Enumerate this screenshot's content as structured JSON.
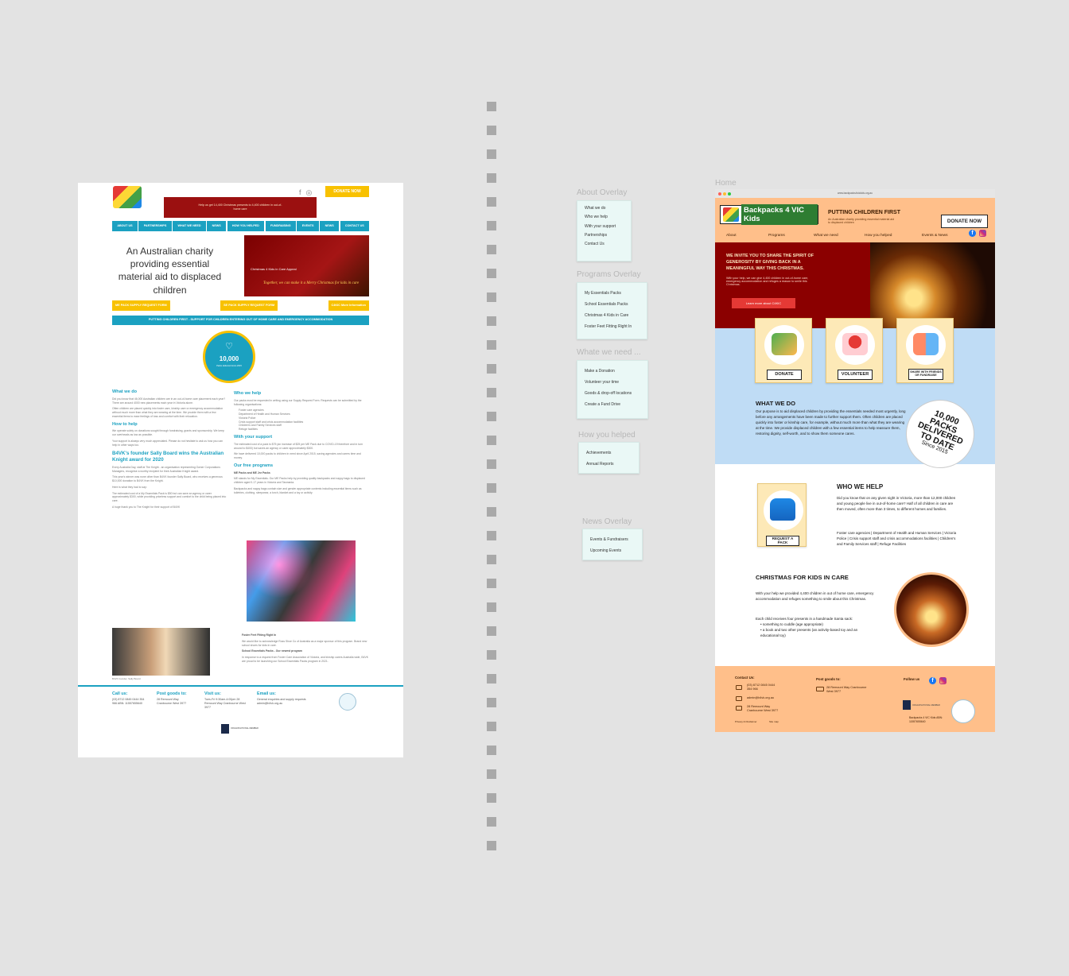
{
  "old_site": {
    "donate": "DONATE NOW",
    "banner": "Help us get 14,400 Christmas presents to 4,400 children in out-of-home care",
    "nav": [
      "ABOUT US",
      "PARTNERSHIPS",
      "WHAT WE NEED",
      "NEWS",
      "HOW YOU HELPED",
      "FUNDRAISING",
      "EVENTS",
      "NEWS",
      "CONTACT US"
    ],
    "hero_title": "An Australian charity providing essential material aid to displaced children",
    "hero_caption": "Christmas 4 Kids in Care Appeal",
    "hero_script": "Together, we can make it a Merry Christmas for kids in care",
    "buttons": [
      "ME PACK SUPPLY REQUEST FORM",
      "SE PACK SUPPLY REQUEST FORM",
      "C4KIC More Information"
    ],
    "strip": "PUTTING CHILDREN FIRST - SUPPORT FOR CHILDREN ENTERING OUT OF HOME CARE AND EMERGENCY ACCOMMODATION",
    "counter_num": "10,000",
    "counter_label": "Packs delivered since 2015",
    "what_we_do_h": "What we do",
    "what_we_do_p": "Did you know that 46,000 Australian children are in an out-of-home care placement each year? There are around 4000 new placements each year in Victoria alone.",
    "what_we_do_p2": "Often children are placed quickly into foster care, kinship care or emergency accommodation without much more than what they are wearing at the time. We provide them with a few essential items to ease feelings of loss and comfort with their relocation.",
    "how_to_help_h": "How to help",
    "how_to_help_p": "We operate solely on donations sought through fundraising, grants and sponsorship. We keep our overheads as low as possible.",
    "how_to_help_p2": "Your support is always very much appreciated. Please do not hesitate to ask us how you can help in other ways too.",
    "award_h": "B4VK's founder Sally Board wins the Australian Knight award for 2020",
    "award_p": "Every Australia Day, staff at The Knight - an organisation representing Owner Corporations Managers, recognise a worthy recipient for their Australian Knight award.",
    "award_p2": "This year's winner was none other than B4VK founder Sally Board, who receives a generous $10,000 donation to B4VK from the Knight.",
    "award_p3": "Here is what they had to say:",
    "award_p4": "The estimated cost of a My Essentials Pack is $50 but can save an agency or carer approximately $300, while providing priceless support and comfort to the child being placed into care.",
    "award_p5": "A huge thank you to The Knight for their support of B4VK",
    "sally_caption": "B4VK founder, Sally Board",
    "who_we_help_h": "Who we help",
    "who_we_help_p": "Our packs must be requested in writing using our Supply Request Form. Requests can be submitted by the following organisations:",
    "who_we_help_list": [
      "Foster care agencies",
      "Department of Health and Human Services",
      "Victoria Police",
      "Crisis support staff and crisis accommodation facilities",
      "Children's and Family Services staff",
      "Refuge facilities"
    ],
    "support_h": "With your support",
    "support_p": "The estimated cost of a pack is $75 (an increase of $25 per ME Pack due to COVID-19 therefore and in turn around to $400) but saves an agency or carer approximately $300.",
    "support_p2": "We have delivered 10,000 packs to children in need since April 2015, saving agencies and carers time and money.",
    "programs_h": "Our free programs",
    "programs_sub": "ME Packs and ME Jnr Packs",
    "programs_p": "ME stands for My Essentials. Our ME Packs help by providing quality backpacks and nappy bags to displaced children aged 0-17 years in Victoria and Tasmania.",
    "programs_p2": "Backpacks and nappy bags contain size and gender appropriate contents including essential items such as toiletries, clothing, sleepwear, a torch, blanket and a toy or activity.",
    "foster_h": "Foster Feet Fitting Right In",
    "foster_p": "We would like to acknowledge Ross Shoe Co of Australia as a major sponsor of this program. Brand new school shoes for kids in care.",
    "school_h": "School Essentials Packs - Our newest program",
    "school_p": "In response to a request from Foster Care Association of Victoria, and kinship carers Australia wide, B4VK are proud to be launching our School Essentials Packs program in 2021.",
    "footer": [
      {
        "h": "Call us:",
        "t": "(03) 8712 0845 0444 354 966 ABN: 11557655640"
      },
      {
        "h": "Post goods to:",
        "t": "28 Remount Way Cranbourne West 3977"
      },
      {
        "h": "Visit us:",
        "t": "Tues-Fri 9:30am-4:00pm 28 Remount Way Cranbourne West 3977"
      },
      {
        "h": "Email us:",
        "t": "General enquiries and supply requests admin@b4vk.org.au"
      }
    ],
    "footer_org": "ORGANISATIONAL MEMBER"
  },
  "overlays": [
    {
      "title": "About Overlay",
      "items": [
        "What we do",
        "Who we help",
        "With your support",
        "Partnerships",
        "Contact Us"
      ]
    },
    {
      "title": "Programs Overlay",
      "items": [
        "My Essentials Packs",
        "School Essentials Packs",
        "Christmas 4 Kids in Care",
        "Foster Feet Fitting Right In"
      ]
    },
    {
      "title": "Whate we need ...",
      "items": [
        "Make a Donation",
        "Volunteer your time",
        "Goods & drop-off locations",
        "Create a Fund Drive"
      ]
    },
    {
      "title": "How you helped",
      "items": [
        "Achievements",
        "Annual Reports"
      ]
    },
    {
      "title": "News Overlay",
      "items": [
        "Events & Fundraisers",
        "Upcoming Events"
      ]
    }
  ],
  "home": {
    "frame_label": "Home",
    "url": "www.backpacks4vickids.org.au",
    "logo_text": "Backpacks 4 VIC Kids",
    "slogan": "PUTTING CHILDREN FIRST",
    "slogan_sub": "An Australian charity providing essential material aid to displaced children",
    "donate": "DONATE NOW",
    "nav": [
      "About",
      "Programs",
      "What we need",
      "How you helped",
      "Events & News"
    ],
    "hero_title": "WE INVITE YOU TO SHARE THE SPIRIT OF GENEROSITY BY GIVING BACK IN A MEANINGFUL WAY THIS CHRISTMAS.",
    "hero_text": "With your help, we can give 4,400 children in out-of-home care, emergency accommodation and refuges a reason to smile this Christmas.",
    "hero_btn": "Learn more about C4KIC",
    "cards": [
      "DONATE",
      "VOLUNTEER",
      "SHARE WITH FRIENDS OR FUNDRAISE"
    ],
    "what_we_do_title": "WHAT WE DO",
    "what_we_do_text": "Our purpose is to aid displaced children by providing the essentials needed most urgently, long before any arrangements have been made to further support them. Often children are placed quickly into foster or kinship care, for example, without much more than what they are wearing at the time. We provide displaced children with a few essential items to help reassure them, restoring dignity, self-worth, and to show them someone cares.",
    "stamp_1": "10,000",
    "stamp_2": "PACKS",
    "stamp_3": "DELIVERED",
    "stamp_4": "TO DATE",
    "stamp_5": "Since 2015",
    "who_title": "WHO WE HELP",
    "who_text": "Did you know that on any given night in Victoria, more than 12,000 children and young people live in out-of-home care? Half of all children in care are then moved, often more than 3 times, to different homes and families.",
    "who_list": "Foster care agencies | Department of Health and Human Services | Victoria Police | Crisis support staff and crisis accommodations facilities | Children's and Family Services staff | Refuge Facilities",
    "request_btn": "REQUEST A PACK",
    "xmas_title": "CHRISTMAS FOR KIDS IN CARE",
    "xmas_text": "With your help we provided 4,400 children in out of home care, emergency accommodation and refuges something to smile about this Christmas.",
    "xmas_text2": "Each child receives four presents in a handmade Santa sack:",
    "xmas_list": [
      "something to cuddle (age appropriate)",
      "a book and two other presents (an activity-based toy and an educational toy)"
    ],
    "footer_contact_h": "Contact Us:",
    "footer_phone": "(03) 8712 0845 0444 354 966",
    "footer_email": "admin@b4vk.org.au",
    "footer_address": "28 Remount Way Cranbourne West 3977",
    "footer_post_h": "Post goods to:",
    "footer_post": "28 Remount Way Cranbourne West 3977",
    "footer_follow": "Follow us",
    "footer_org": "ORGANISATIONAL MEMBER",
    "footer_abn": "Backpacks 4 VIC Kids ABN: 11557655640",
    "footer_small_1": "Privacy & Disclaimer",
    "footer_small_2": "Site map"
  }
}
